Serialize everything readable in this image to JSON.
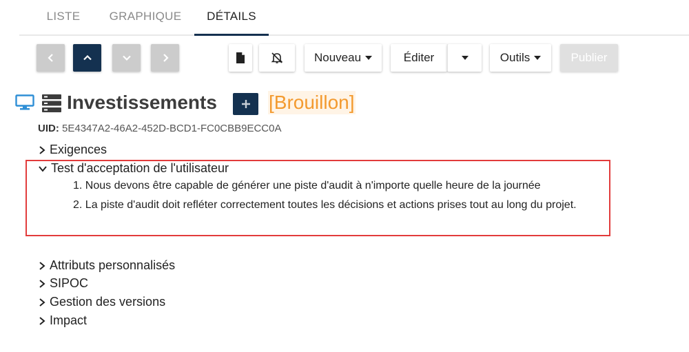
{
  "tabs": [
    {
      "label": "LISTE",
      "active": false
    },
    {
      "label": "GRAPHIQUE",
      "active": false
    },
    {
      "label": "DÉTAILS",
      "active": true
    }
  ],
  "toolbar": {
    "nav": [
      {
        "icon": "chevron-left-icon"
      },
      {
        "icon": "chevron-up-icon",
        "active": true
      },
      {
        "icon": "chevron-down-icon"
      },
      {
        "icon": "chevron-right-icon"
      }
    ],
    "doc_icon": "document-icon",
    "bell_icon": "bell-off-icon",
    "new_label": "Nouveau",
    "edit_label": "Éditer",
    "tools_label": "Outils",
    "publish_label": "Publier"
  },
  "header": {
    "title": "Investissements",
    "status": "[Brouillon]",
    "uid_label": "UID:",
    "uid_value": "5E4347A2-46A2-452D-BCD1-FC0CBB9ECC0A"
  },
  "sections": {
    "exigences": "Exigences",
    "uat": "Test d'acceptation de l'utilisateur",
    "uat_items": [
      "1. Nous devons être capable de générer une piste d'audit à n'importe quelle heure de la journée",
      "2. La piste d'audit doit refléter correctement toutes les décisions et actions prises tout au long du projet."
    ],
    "custom_attrs": "Attributs personnalisés",
    "sipoc": "SIPOC",
    "versions": "Gestion des versions",
    "impact": "Impact"
  },
  "colors": {
    "primary": "#143150",
    "draft": "#f39a2f",
    "highlight_border": "#e23b3b",
    "monitor_icon": "#2f8fd6"
  }
}
